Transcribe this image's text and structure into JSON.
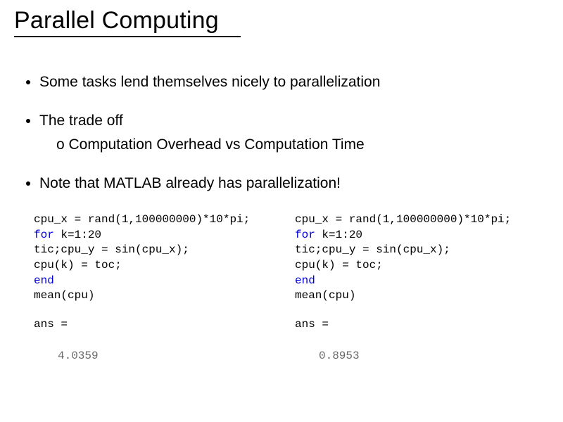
{
  "title": "Parallel Computing",
  "bullets": {
    "b1": "Some tasks lend themselves nicely to parallelization",
    "b2": "The trade off",
    "b2a": "Computation Overhead vs Computation Time",
    "b3": "Note that MATLAB already has parallelization!"
  },
  "code_left": {
    "l1a": "cpu_x = rand(1,100000000)*10*pi;",
    "l2_kw": "for",
    "l2_rest": " k=1:20",
    "l3": "tic;cpu_y = sin(cpu_x);",
    "l4": "cpu(k) = toc;",
    "l5_kw": "end",
    "l6": "mean(cpu)",
    "ans_label": "ans =",
    "ans_value": "4.0359"
  },
  "code_right": {
    "l1a": "cpu_x = rand(1,100000000)*10*pi;",
    "l2_kw": "for",
    "l2_rest": " k=1:20",
    "l3": "tic;cpu_y = sin(cpu_x);",
    "l4": "cpu(k) = toc;",
    "l5_kw": "end",
    "l6": "mean(cpu)",
    "ans_label": "ans =",
    "ans_value": "0.8953"
  }
}
